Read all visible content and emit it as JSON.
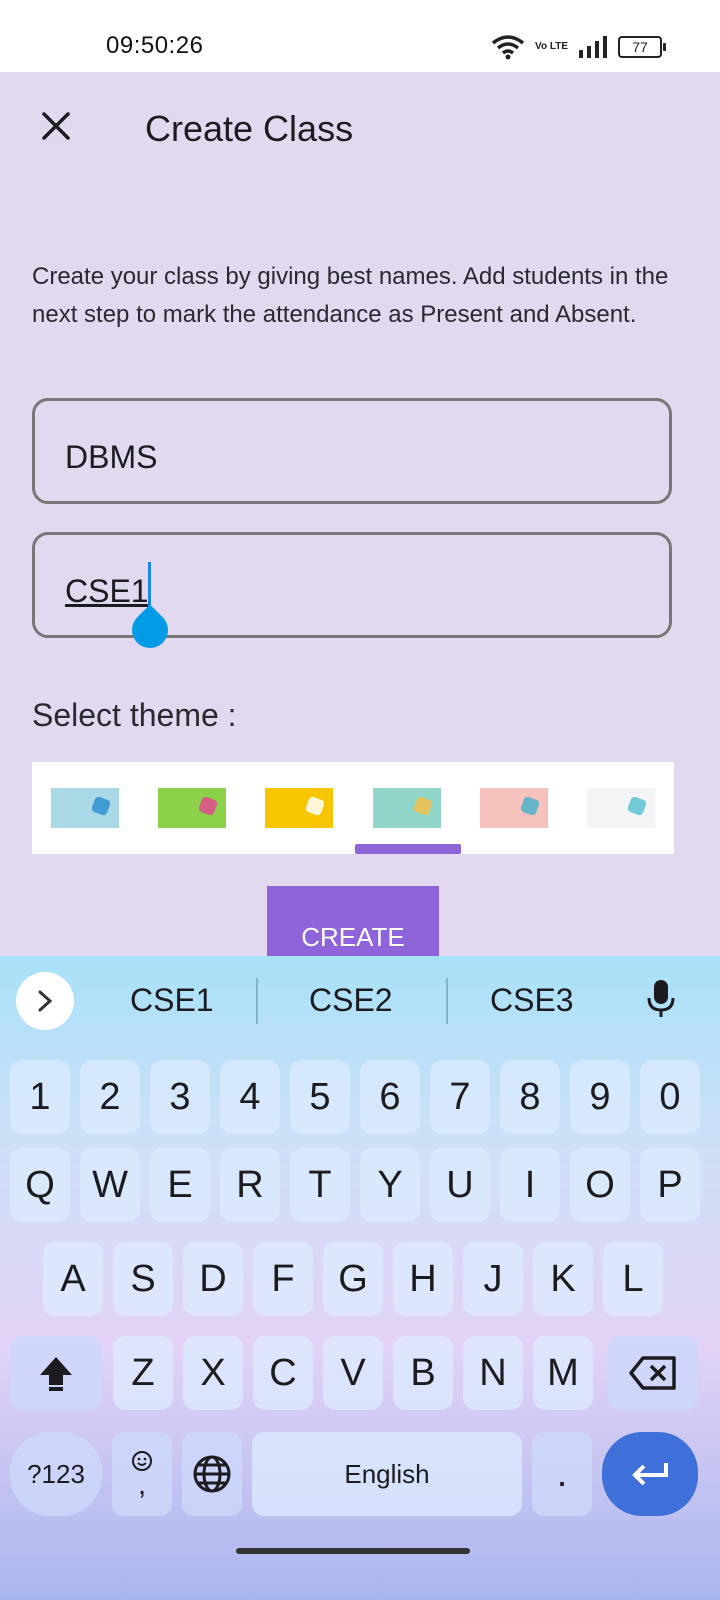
{
  "status_bar": {
    "time": "09:50:26",
    "network_label": "Vo LTE",
    "battery": "77"
  },
  "header": {
    "title": "Create Class",
    "close_icon": "close-icon"
  },
  "form": {
    "description": "Create your class by giving best names. Add students in the next step to mark the attendance as Present and Absent.",
    "class_name_value": "DBMS",
    "section_value": "CSE1",
    "select_theme_label": "Select theme :",
    "selected_theme_index": 3,
    "themes": [
      {
        "color": "#a9d9e6",
        "accent": "#2f8fd0"
      },
      {
        "color": "#8cd14a",
        "accent": "#e24a8e"
      },
      {
        "color": "#f7c600",
        "accent": "#ffffff"
      },
      {
        "color": "#8fd5c8",
        "accent": "#f2c14e"
      },
      {
        "color": "#f6c2bd",
        "accent": "#4bb2c9"
      },
      {
        "color": "#f2f4f6",
        "accent": "#5ac2d0"
      }
    ],
    "create_label": "CREATE"
  },
  "keyboard": {
    "suggestions": [
      "CSE1",
      "CSE2",
      "CSE3"
    ],
    "numbers": [
      "1",
      "2",
      "3",
      "4",
      "5",
      "6",
      "7",
      "8",
      "9",
      "0"
    ],
    "row1": [
      "Q",
      "W",
      "E",
      "R",
      "T",
      "Y",
      "U",
      "I",
      "O",
      "P"
    ],
    "row2": [
      "A",
      "S",
      "D",
      "F",
      "G",
      "H",
      "J",
      "K",
      "L"
    ],
    "row3": [
      "Z",
      "X",
      "C",
      "V",
      "B",
      "N",
      "M"
    ],
    "symbols_label": "?123",
    "emoji_comma_label": ",",
    "space_label": "English",
    "period_label": "."
  },
  "colors": {
    "background": "#e2d8f0",
    "accent": "#8f63d9",
    "cursor": "#039be5",
    "enter_key": "#3f6fd8"
  }
}
